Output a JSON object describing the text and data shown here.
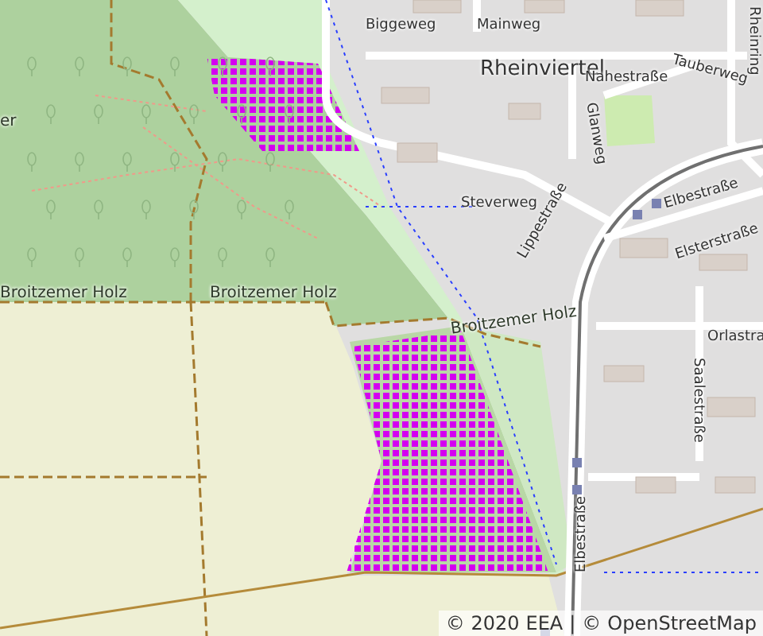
{
  "map_labels": [
    {
      "kind": "street",
      "text": "Biggeweg"
    },
    {
      "kind": "street",
      "text": "Mainweg"
    },
    {
      "kind": "district",
      "text": "Rheinviertel"
    },
    {
      "kind": "street",
      "text": "Nahestraße"
    },
    {
      "kind": "street",
      "text": "Tauberweg"
    },
    {
      "kind": "street",
      "text": "Rheinring"
    },
    {
      "kind": "street",
      "text": "Glanweg"
    },
    {
      "kind": "street",
      "text": "Steverweg"
    },
    {
      "kind": "street",
      "text": "Lippestraße"
    },
    {
      "kind": "street",
      "text": "Elbestraße"
    },
    {
      "kind": "street",
      "text": "Elsterstraße"
    },
    {
      "kind": "forest",
      "text": "er"
    },
    {
      "kind": "forest",
      "text": "Broitzemer Holz"
    },
    {
      "kind": "forest",
      "text": "Broitzemer Holz"
    },
    {
      "kind": "forest",
      "text": "Broitzemer Holz"
    },
    {
      "kind": "street",
      "text": "Orlastra"
    },
    {
      "kind": "street",
      "text": "Saalestraße"
    },
    {
      "kind": "street",
      "text": "Elbestraße"
    }
  ],
  "attribution": {
    "prefix": "©",
    "year": "2020",
    "source": "EEA",
    "separator": "|",
    "osm_prefix": "©",
    "osm": "OpenStreetMap"
  }
}
